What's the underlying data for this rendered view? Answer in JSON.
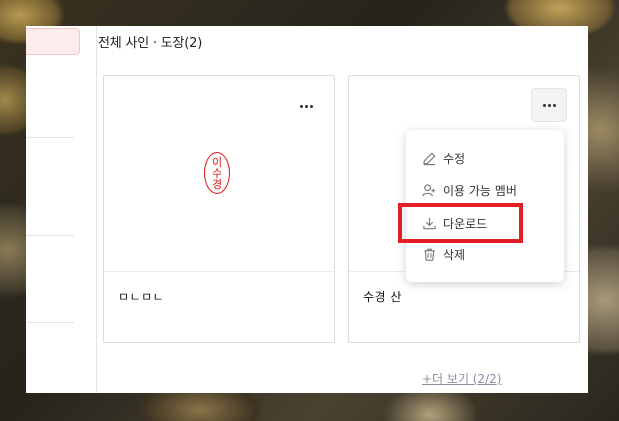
{
  "section": {
    "title": "전체 사인 · 도장(2)"
  },
  "cards": [
    {
      "name": "ㅁㄴㅁㄴ",
      "seal_chars": [
        "이",
        "수",
        "경"
      ]
    },
    {
      "name": "수경 산"
    }
  ],
  "menu": {
    "items": [
      {
        "label": "수정",
        "icon": "pencil-icon"
      },
      {
        "label": "이용 가능 멤버",
        "icon": "add-user-icon"
      },
      {
        "label": "다운로드",
        "icon": "download-icon"
      },
      {
        "label": "삭제",
        "icon": "trash-icon"
      }
    ]
  },
  "footer": {
    "more_label": "+더 보기 (2/2)"
  },
  "colors": {
    "seal": "#dd1111",
    "highlight": "#e41e26",
    "link": "#8a8fa0"
  }
}
